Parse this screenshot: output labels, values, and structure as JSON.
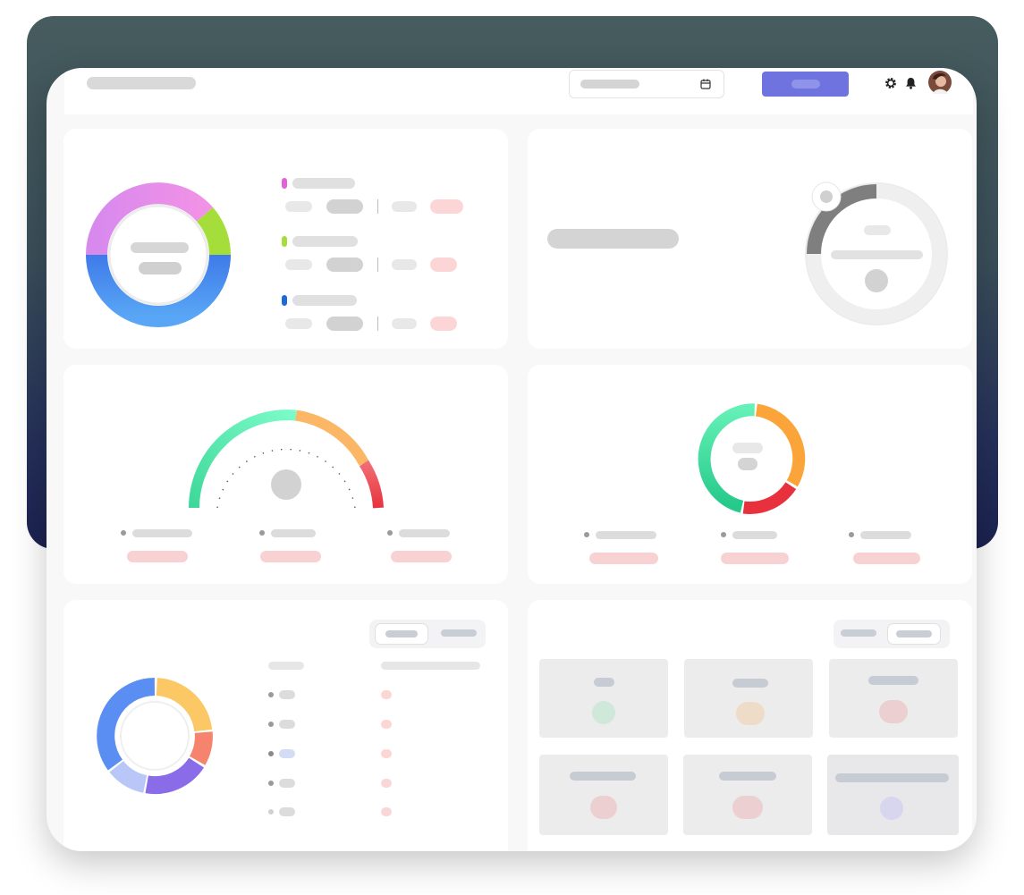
{
  "header": {
    "date_picker_icon": "calendar-icon",
    "settings_icon": "gear-icon",
    "notifications_icon": "bell-icon",
    "avatar": "user-avatar",
    "accent": "#6f73e0"
  },
  "colors": {
    "placeholder_gray": "#d6d6d6",
    "placeholder_light": "#e8e8e8",
    "placeholder_pink": "#fcd6d6",
    "purple": "#e58bef",
    "lime": "#a5de3a",
    "blue": "#4a86f0",
    "green_gauge": "#4fe3a5",
    "orange_gauge": "#fbb766",
    "red_gauge": "#e7333d"
  },
  "tabs": {
    "left_active_index": 0,
    "right_active_index": 1
  }
}
